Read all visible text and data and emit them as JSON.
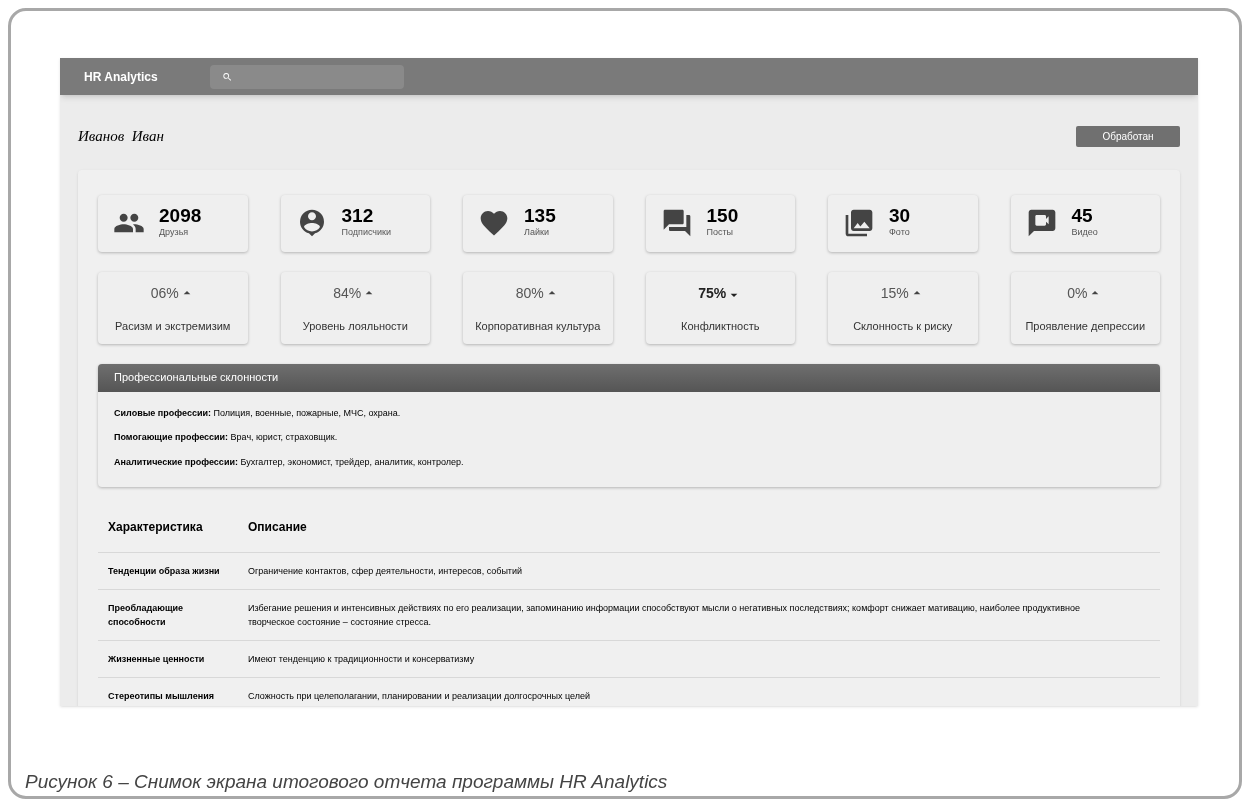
{
  "app": {
    "title": "HR Analytics"
  },
  "person": {
    "name": "Иванов  Иван",
    "status_button": "Обработан"
  },
  "stats": [
    {
      "value": "2098",
      "label": "Друзья"
    },
    {
      "value": "312",
      "label": "Подписчики"
    },
    {
      "value": "135",
      "label": "Лайки"
    },
    {
      "value": "150",
      "label": "Посты"
    },
    {
      "value": "30",
      "label": "Фото"
    },
    {
      "value": "45",
      "label": "Видео"
    }
  ],
  "metrics": [
    {
      "value": "06%",
      "declining": false,
      "highlighted": false,
      "label": "Расизм и экстремизим"
    },
    {
      "value": "84%",
      "declining": false,
      "highlighted": false,
      "label": "Уровень лояльности"
    },
    {
      "value": "80%",
      "declining": false,
      "highlighted": false,
      "label": "Корпоративная культура"
    },
    {
      "value": "75%",
      "declining": true,
      "highlighted": true,
      "label": "Конфликтность"
    },
    {
      "value": "15%",
      "declining": false,
      "highlighted": false,
      "label": "Склонность к риску"
    },
    {
      "value": "0%",
      "declining": false,
      "highlighted": false,
      "label": "Проявление депрессии"
    }
  ],
  "professions": {
    "title": "Профессиональные склонности",
    "lines": [
      "**Силовые профессии:** Полиция, военные, пожарные, МЧС, охрана.",
      "**Помогающие профессии:** Врач, юрист, страховщик.",
      "**Аналитические профессии:** Бухгалтер, экономист, трейдер, аналитик, контролер."
    ]
  },
  "table": {
    "columns": [
      "Характеристика",
      "Описание"
    ],
    "rows": [
      {
        "characteristic": "Тенденции образа жизни",
        "description": "Ограничение контактов, сфер деятельности, интересов, событий"
      },
      {
        "characteristic": "Преобладающие способности",
        "description": "Избегание решения и интенсивных действиях по его реализации, запоминанию информации способствуют мысли о негативных последствиях; комфорт снижает мативацию, наиболее продуктивное творческое состояние – состояние стресса."
      },
      {
        "characteristic": "Жизненные ценности",
        "description": "Имеют тенденцию к традиционности и консерватизму"
      },
      {
        "characteristic": "Стереотипы мышления",
        "description": "Сложность при целеполагании, планировании и реализации долгосрочных целей"
      }
    ]
  },
  "caption": "Рисунок 6 – Снимок экрана итогового отчета программы HR Analytics"
}
